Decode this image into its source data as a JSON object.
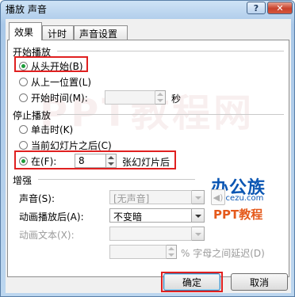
{
  "window": {
    "title": "播放 声音",
    "help_label": "?",
    "close_label": "✕"
  },
  "tabs": [
    "效果",
    "计时",
    "声音设置"
  ],
  "start": {
    "heading": "开始播放",
    "options": [
      "从头开始(B)",
      "从上一位置(L)",
      "开始时间(M):"
    ],
    "selected": 0,
    "time_value": "",
    "seconds_label": "秒"
  },
  "stop": {
    "heading": "停止播放",
    "options": [
      "单击时(K)",
      "当前幻灯片之后(C)",
      "在(F):"
    ],
    "selected": 2,
    "slides_value": "8",
    "after_slides_label": "张幻灯片后"
  },
  "enhance": {
    "heading": "增强",
    "sound_label": "声音(S):",
    "sound_value": "[无声音]",
    "after_anim_label": "动画播放后(A):",
    "after_anim_value": "不变暗",
    "anim_text_label": "动画文本(X):",
    "anim_text_value": "",
    "delay_value": "",
    "delay_label": "% 字母之间延迟(D)"
  },
  "watermark": {
    "brand_cn": "办公族",
    "brand_url": "Officezu.com",
    "brand_ppt": "PPT教程",
    "bg_text": "PPT教程网"
  },
  "buttons": {
    "ok": "确定",
    "cancel": "取消"
  },
  "colors": {
    "highlight": "#e02020",
    "brand_blue": "#0b56b3",
    "brand_orange": "#e55a1c"
  },
  "icons": {
    "speaker": "speaker-icon"
  }
}
